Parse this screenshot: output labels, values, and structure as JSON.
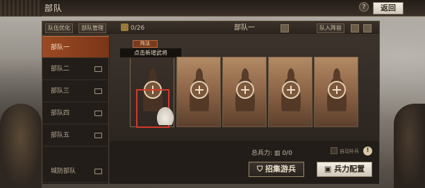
{
  "top": {
    "title": "部队",
    "help": "?",
    "back_label": "返回"
  },
  "header": {
    "btn_left1": "队伍优化",
    "btn_left2": "部队管理",
    "count": "0/26",
    "team_name": "部队一",
    "btn_in_team": "队入阵容"
  },
  "sidebar": {
    "items": [
      {
        "label": "部队一",
        "active": true
      },
      {
        "label": "部队二"
      },
      {
        "label": "部队三"
      },
      {
        "label": "部队四"
      },
      {
        "label": "部队五"
      },
      {
        "label": "城防部队"
      }
    ]
  },
  "content": {
    "position_btn": "阵法",
    "tooltip": "点击新增武将"
  },
  "footer": {
    "total_label": "总兵力:",
    "total_value": "0/0",
    "auto_label": "自动补兵",
    "recruit_label": "招集游兵",
    "config_label": "兵力配置"
  },
  "colors": {
    "active_tab": "#9b4a23",
    "highlight": "#d23a2a"
  }
}
